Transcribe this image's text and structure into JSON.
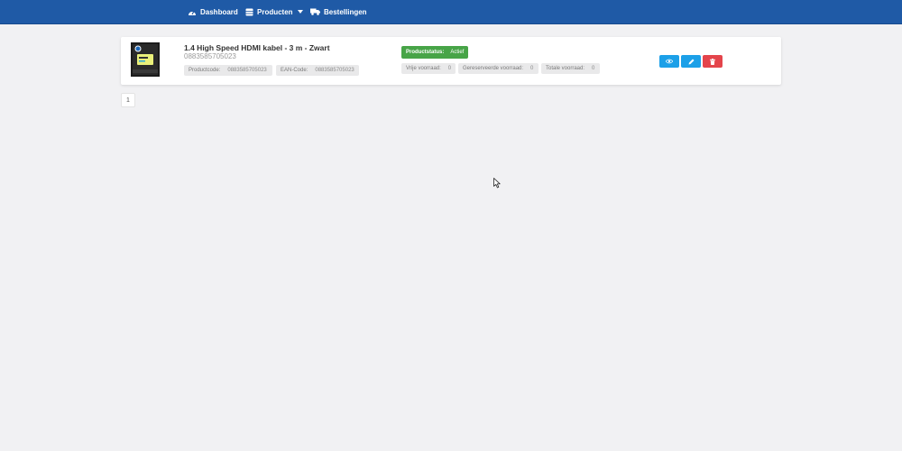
{
  "nav": {
    "dashboard": "Dashboard",
    "producten": "Producten",
    "bestellingen": "Bestellingen"
  },
  "product": {
    "title": "1.4 High Speed HDMI kabel - 3 m - Zwart",
    "subtitle": "0883585705023",
    "productcode_label": "Productcode:",
    "productcode_value": "0883585705023",
    "ean_label": "EAN-Code:",
    "ean_value": "0883585705023",
    "status_label": "Productstatus:",
    "status_value": "Actief",
    "vrije_label": "Vrije voorraad:",
    "vrije_value": "0",
    "gereserveerd_label": "Gereserveerde voorraad:",
    "gereserveerd_value": "0",
    "totaal_label": "Totale voorraad:",
    "totaal_value": "0"
  },
  "pagination": {
    "current": "1"
  },
  "icons": {
    "dashboard": "dashboard-icon",
    "producten": "box-icon",
    "bestellingen": "truck-icon",
    "view": "eye-icon",
    "edit": "pencil-icon",
    "delete": "trash-icon"
  },
  "colors": {
    "navbar": "#1f5aa6",
    "status_active": "#47a447",
    "button_primary": "#1ca0e8",
    "button_danger": "#e4444b"
  }
}
